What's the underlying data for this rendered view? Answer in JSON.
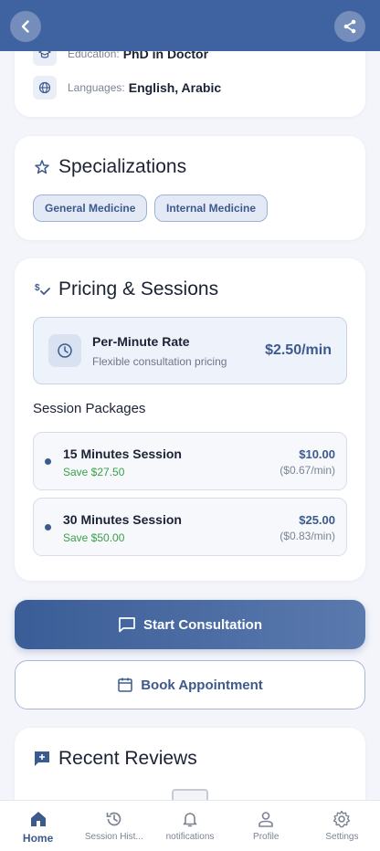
{
  "header": {
    "back_icon": "arrow-back-icon",
    "share_icon": "share-icon",
    "color": "#3f62a0"
  },
  "about": {
    "education_label": "Education:",
    "education_value": "PhD in Doctor",
    "languages_label": "Languages:",
    "languages_value": "English, Arabic"
  },
  "specializations": {
    "title": "Specializations",
    "items": [
      "General Medicine",
      "Internal Medicine"
    ]
  },
  "pricing": {
    "title": "Pricing & Sessions",
    "rate_title": "Per-Minute Rate",
    "rate_subtitle": "Flexible consultation pricing",
    "rate_price": "$2.50/min",
    "packages_title": "Session Packages",
    "packages": [
      {
        "name": "15 Minutes Session",
        "save": "Save $27.50",
        "price": "$10.00",
        "per_min": "($0.67/min)"
      },
      {
        "name": "30 Minutes Session",
        "save": "Save $50.00",
        "price": "$25.00",
        "per_min": "($0.83/min)"
      }
    ]
  },
  "actions": {
    "start_consultation": "Start Consultation",
    "book_appointment": "Book Appointment"
  },
  "reviews": {
    "title": "Recent Reviews"
  },
  "bottom_nav": {
    "items": [
      {
        "label": "Home",
        "icon": "home-icon",
        "active": true
      },
      {
        "label": "Session Hist...",
        "icon": "history-icon",
        "active": false
      },
      {
        "label": "notifications",
        "icon": "bell-icon",
        "active": false
      },
      {
        "label": "Profile",
        "icon": "person-icon",
        "active": false
      },
      {
        "label": "Settings",
        "icon": "gear-icon",
        "active": false
      }
    ]
  },
  "colors": {
    "accent": "#3c5a8e",
    "save_green": "#3aa04a"
  }
}
